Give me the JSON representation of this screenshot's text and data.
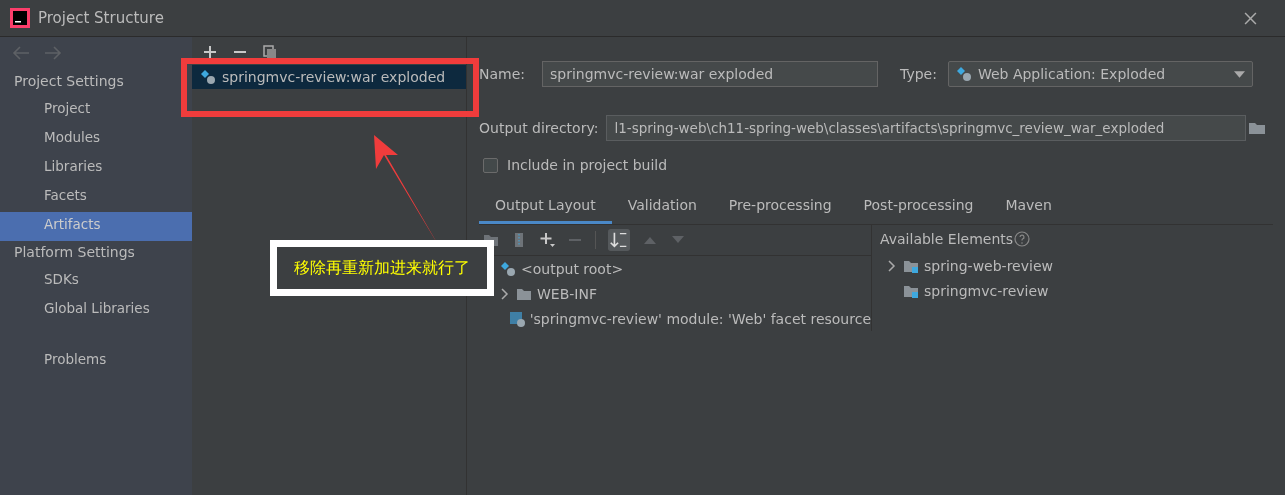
{
  "window": {
    "title": "Project Structure"
  },
  "sidebar": {
    "sections": [
      {
        "heading": "Project Settings",
        "items": [
          {
            "label": "Project",
            "selected": false
          },
          {
            "label": "Modules",
            "selected": false
          },
          {
            "label": "Libraries",
            "selected": false
          },
          {
            "label": "Facets",
            "selected": false
          },
          {
            "label": "Artifacts",
            "selected": true
          }
        ]
      },
      {
        "heading": "Platform Settings",
        "items": [
          {
            "label": "SDKs",
            "selected": false
          },
          {
            "label": "Global Libraries",
            "selected": false
          }
        ]
      }
    ],
    "extra_items": [
      {
        "label": "Problems",
        "selected": false
      }
    ]
  },
  "artifacts": [
    {
      "name": "springmvc-review:war exploded",
      "selected": true
    }
  ],
  "form": {
    "name_label": "Name:",
    "name_value": "springmvc-review:war exploded",
    "type_label": "Type:",
    "type_value": "Web Application: Exploded",
    "output_label": "Output directory:",
    "output_value": "l1-spring-web\\ch11-spring-web\\classes\\artifacts\\springmvc_review_war_exploded",
    "include_label": "Include in project build",
    "include_checked": false
  },
  "tabs": [
    {
      "label": "Output Layout",
      "selected": true
    },
    {
      "label": "Validation",
      "selected": false
    },
    {
      "label": "Pre-processing",
      "selected": false
    },
    {
      "label": "Post-processing",
      "selected": false
    },
    {
      "label": "Maven",
      "selected": false
    }
  ],
  "layout_tree": [
    {
      "label": "<output root>",
      "kind": "root",
      "children": [
        {
          "label": "WEB-INF",
          "kind": "folder",
          "expanded": false
        },
        {
          "label": "'springmvc-review' module: 'Web' facet resource",
          "kind": "facet"
        }
      ]
    }
  ],
  "available": {
    "heading": "Available Elements",
    "items": [
      {
        "label": "spring-web-review",
        "expandable": true
      },
      {
        "label": "springmvc-review",
        "expandable": false
      }
    ]
  },
  "annotation": {
    "text": "移除再重新加进来就行了"
  }
}
